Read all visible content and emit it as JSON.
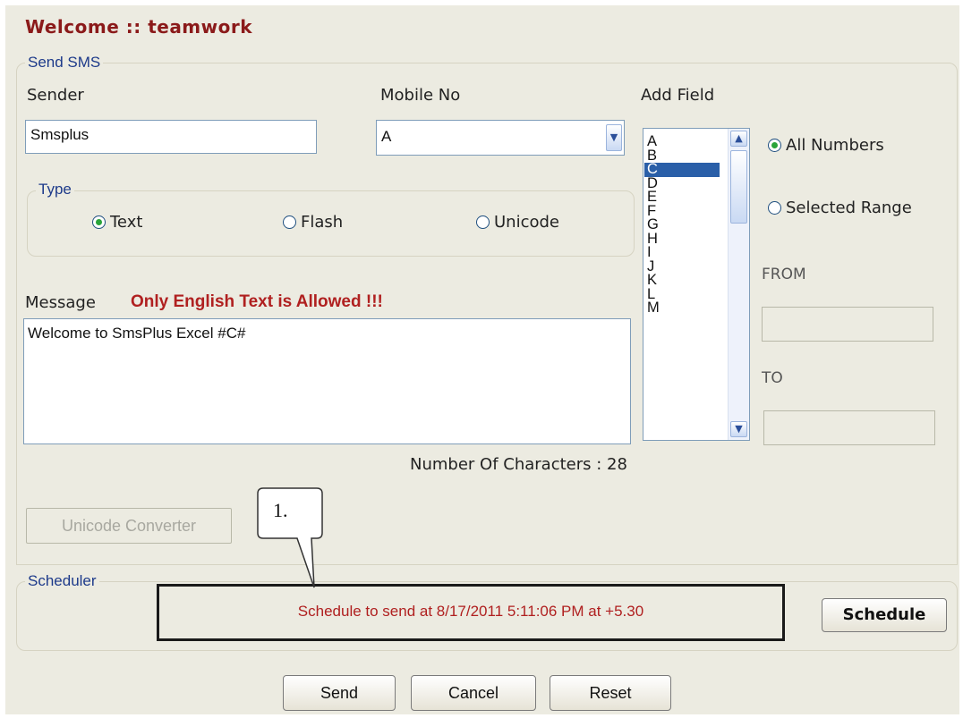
{
  "title": "Welcome :: teamwork",
  "send_sms": {
    "legend": "Send SMS",
    "sender_label": "Sender",
    "sender_value": "Smsplus",
    "mobile_label": "Mobile No",
    "mobile_value": "A",
    "add_field_label": "Add Field",
    "add_field_items": [
      "A",
      "B",
      "C",
      "D",
      "E",
      "F",
      "G",
      "H",
      "I",
      "J",
      "K",
      "L",
      "M"
    ],
    "add_field_selected": "C",
    "type": {
      "legend": "Type",
      "options": [
        "Text",
        "Flash",
        "Unicode"
      ],
      "selected": "Text"
    },
    "range": {
      "all_numbers": "All Numbers",
      "selected_range": "Selected Range",
      "selected": "All Numbers",
      "from_label": "FROM",
      "to_label": "TO",
      "from_value": "",
      "to_value": ""
    },
    "message_label": "Message",
    "message_warning": "Only English Text is Allowed !!!",
    "message_value": "Welcome to SmsPlus Excel #C#",
    "char_count_text": "Number Of Characters : 28",
    "unicode_converter_label": "Unicode Converter"
  },
  "annotation_callout": "1.",
  "scheduler": {
    "legend": "Scheduler",
    "status_text": "Schedule to send at 8/17/2011 5:11:06 PM at +5.30",
    "schedule_button": "Schedule"
  },
  "footer": {
    "send": "Send",
    "cancel": "Cancel",
    "reset": "Reset"
  },
  "colors": {
    "title": "#8b1a1a",
    "legend": "#1d3a8a",
    "warning": "#b02020",
    "selection": "#2a5fa8",
    "radio_dot": "#2aa43a",
    "background": "#ecebe1"
  }
}
